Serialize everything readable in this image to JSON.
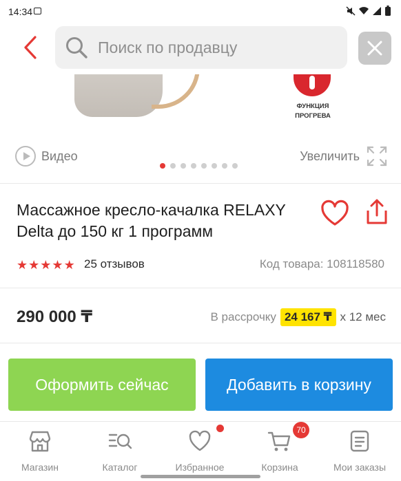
{
  "status_bar": {
    "time": "14:34"
  },
  "search": {
    "placeholder": "Поиск по продавцу"
  },
  "product_image": {
    "badge_text_line1": "ФУНКЦИЯ",
    "badge_text_line2": "ПРОГРЕВА"
  },
  "gallery": {
    "video_label": "Видео",
    "zoom_label": "Увеличить",
    "dots_total": 8,
    "active_dot": 1
  },
  "product": {
    "title": "Массажное кресло-качалка RELAXY\nDelta до 150 кг 1 программ",
    "rating": 5,
    "reviews": "25 отзывов",
    "sku": "Код товара: 108118580",
    "price": "290 000 ₸",
    "installment_prefix": "В рассрочку",
    "installment_amount": "24 167 ₸",
    "installment_suffix": "x 12 мес"
  },
  "actions": {
    "buy_now": "Оформить сейчас",
    "add_to_cart": "Добавить в корзину"
  },
  "bottom_nav": {
    "items": [
      {
        "label": "Магазин",
        "icon": "shop-icon"
      },
      {
        "label": "Каталог",
        "icon": "catalog-icon"
      },
      {
        "label": "Избранное",
        "icon": "heart-icon"
      },
      {
        "label": "Корзина",
        "icon": "cart-icon"
      },
      {
        "label": "Мои заказы",
        "icon": "orders-icon"
      }
    ],
    "cart_count": "70"
  },
  "colors": {
    "accent_red": "#e53935",
    "buy_green": "#8ed552",
    "cart_blue": "#1d8be0",
    "installment_yellow": "#ffe300"
  }
}
